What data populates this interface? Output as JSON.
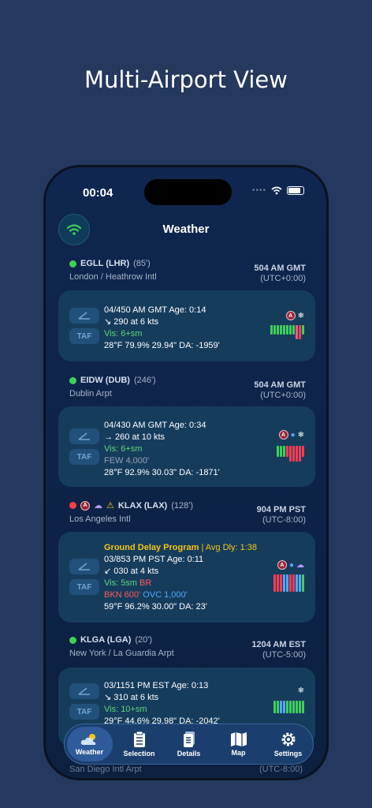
{
  "hero": {
    "title": "Multi-Airport View"
  },
  "status": {
    "time": "00:04"
  },
  "nav": {
    "title": "Weather"
  },
  "stations": [
    {
      "code": "EGLL (LHR)",
      "elev": "(85')",
      "name": "London / Heathrow Intl",
      "time": "504 AM GMT",
      "utc": "(UTC+0:00)",
      "obs": "04/450 AM GMT  Age: 0:14",
      "wind": "↘ 290 at 6 kts",
      "vis": "Vis: 6+sm",
      "temp": "28°F  79.9%  29.94\"  DA: -1959'"
    },
    {
      "code": "EIDW (DUB)",
      "elev": "(246')",
      "name": "Dublin Arpt",
      "time": "504 AM GMT",
      "utc": "(UTC+0:00)",
      "obs": "04/430 AM GMT  Age: 0:34",
      "wind": "→ 260 at 10 kts",
      "vis": "Vis: 6+sm",
      "cloud": "FEW 4,000'",
      "temp": "28°F  92.9%  30.03\"  DA: -1871'"
    },
    {
      "code": "KLAX (LAX)",
      "elev": "(128')",
      "name": "Los Angeles Intl",
      "time": "904 PM PST",
      "utc": "(UTC-8:00)",
      "gdp": "Ground Delay Program",
      "gdp_extra": " | Avg Dly: 1:38",
      "obs": "03/853 PM PST  Age: 0:11",
      "wind": "↙ 030 at 4 kts",
      "vis": "Vis: 5sm",
      "vis_extra": "BR",
      "cloud_bkn": "BKN 600'",
      "cloud_ovc": "OVC 1,000'",
      "temp": "59°F  96.2%  30.00\"  DA: 23'"
    },
    {
      "code": "KLGA (LGA)",
      "elev": "(20')",
      "name": "New York / La Guardia Arpt",
      "time": "1204 AM EST",
      "utc": "(UTC-5:00)",
      "obs": "03/1151 PM EST  Age: 0:13",
      "wind": "↘ 310 at 6 kts",
      "vis": "Vis: 10+sm",
      "temp": "29°F  44.6%  29.98\"  DA: -2042'"
    }
  ],
  "behind": {
    "name": "San Diego Intl Arpt",
    "utc": "(UTC-8:00)"
  },
  "buttons": {
    "taf": "TAF"
  },
  "tabs": [
    "Weather",
    "Selection",
    "Details",
    "Map",
    "Settings"
  ],
  "colors": {
    "accent": "#2f5b9a",
    "vfr_green": "#3fd05a",
    "ifr_red": "#ff3b4e",
    "card_bg": "#163c5c"
  }
}
